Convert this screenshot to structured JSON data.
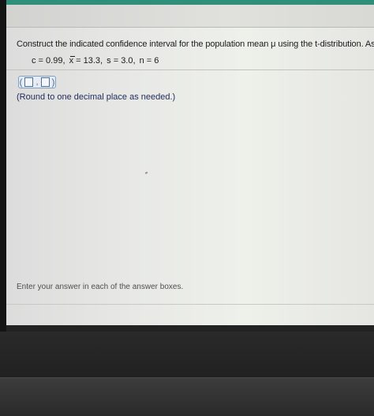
{
  "question": {
    "text": "Construct the indicated confidence interval for the population mean μ using the t-distribution. As"
  },
  "parameters": {
    "c": "c = 0.99,",
    "x_bar_symbol": "x",
    "x_bar_value": " = 13.3,",
    "s": "s = 3.0,",
    "n": "n = 6"
  },
  "answer": {
    "open_paren": "(",
    "separator": ",",
    "close_paren": ")"
  },
  "instructions": {
    "round_note": "(Round to one decimal place as needed.)",
    "enter_answer": "Enter your answer in each of the answer boxes."
  }
}
